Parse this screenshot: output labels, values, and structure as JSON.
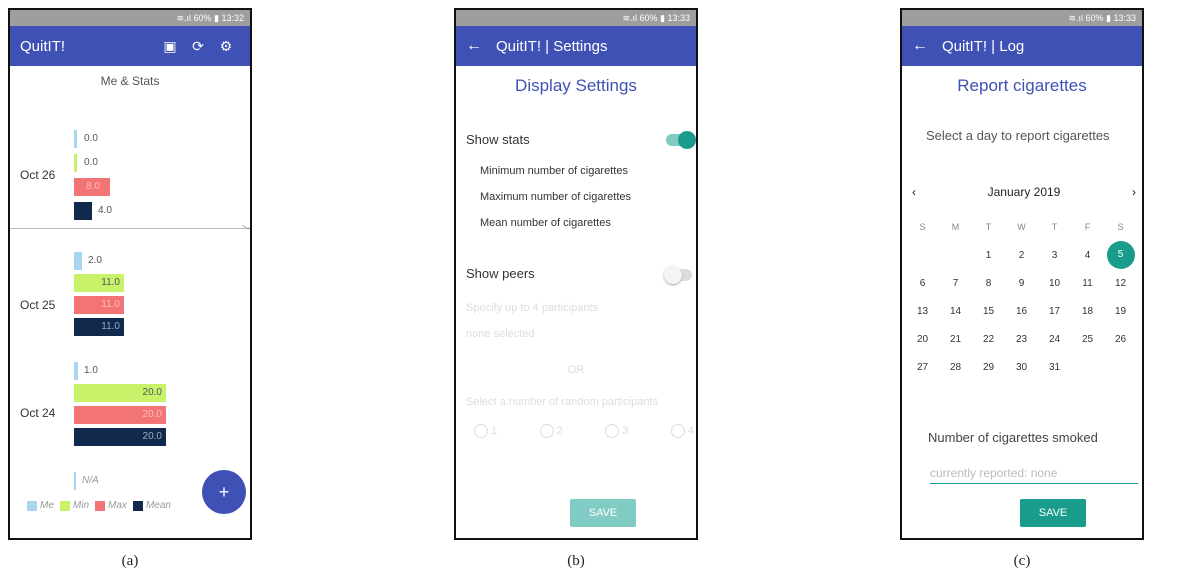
{
  "panel_a": {
    "status": "≋.ıl 60% ▮ 13:32",
    "title": "QuitIT!",
    "section_title": "Me & Stats",
    "days": [
      {
        "label": "Oct 26",
        "me": "0.0",
        "min": "0.0",
        "max": "8.0",
        "mean": "4.0"
      },
      {
        "label": "Oct 25",
        "me": "2.0",
        "min": "11.0",
        "max": "11.0",
        "mean": "11.0"
      },
      {
        "label": "Oct 24",
        "me": "1.0",
        "min": "20.0",
        "max": "20.0",
        "mean": "20.0"
      }
    ],
    "last_me": "N/A",
    "legend": {
      "me": "Me",
      "min": "Min",
      "max": "Max",
      "mean": "Mean"
    },
    "fab": "+",
    "caption": "(a)",
    "colors": {
      "me": "#a8d5f0",
      "min": "#c7f26a",
      "max": "#f27474",
      "mean": "#10294d",
      "appbar": "#3f51b5"
    }
  },
  "panel_b": {
    "status": "≋.ıl 60% ▮ 13:33",
    "title": "QuitIT! | Settings",
    "heading": "Display Settings",
    "show_stats": "Show stats",
    "options": [
      "Minimum number of cigarettes",
      "Maximum number of cigarettes",
      "Mean number of cigarettes"
    ],
    "show_peers": "Show peers",
    "specify": "Specify up to 4 participants",
    "none_selected": "none selected",
    "or": "OR",
    "random": "Select a number of random participants",
    "radios": [
      "1",
      "2",
      "3",
      "4"
    ],
    "save": "SAVE",
    "caption": "(b)"
  },
  "panel_c": {
    "status": "≋.ıl 60% ▮ 13:33",
    "title": "QuitIT! | Log",
    "heading": "Report cigarettes",
    "prompt": "Select a day to report cigarettes",
    "month": "January 2019",
    "weekdays": [
      "S",
      "M",
      "T",
      "W",
      "T",
      "F",
      "S"
    ],
    "selected_day": "5",
    "count_label": "Number of cigarettes smoked",
    "placeholder": "currently reported: none",
    "save": "SAVE",
    "caption": "(c)"
  }
}
